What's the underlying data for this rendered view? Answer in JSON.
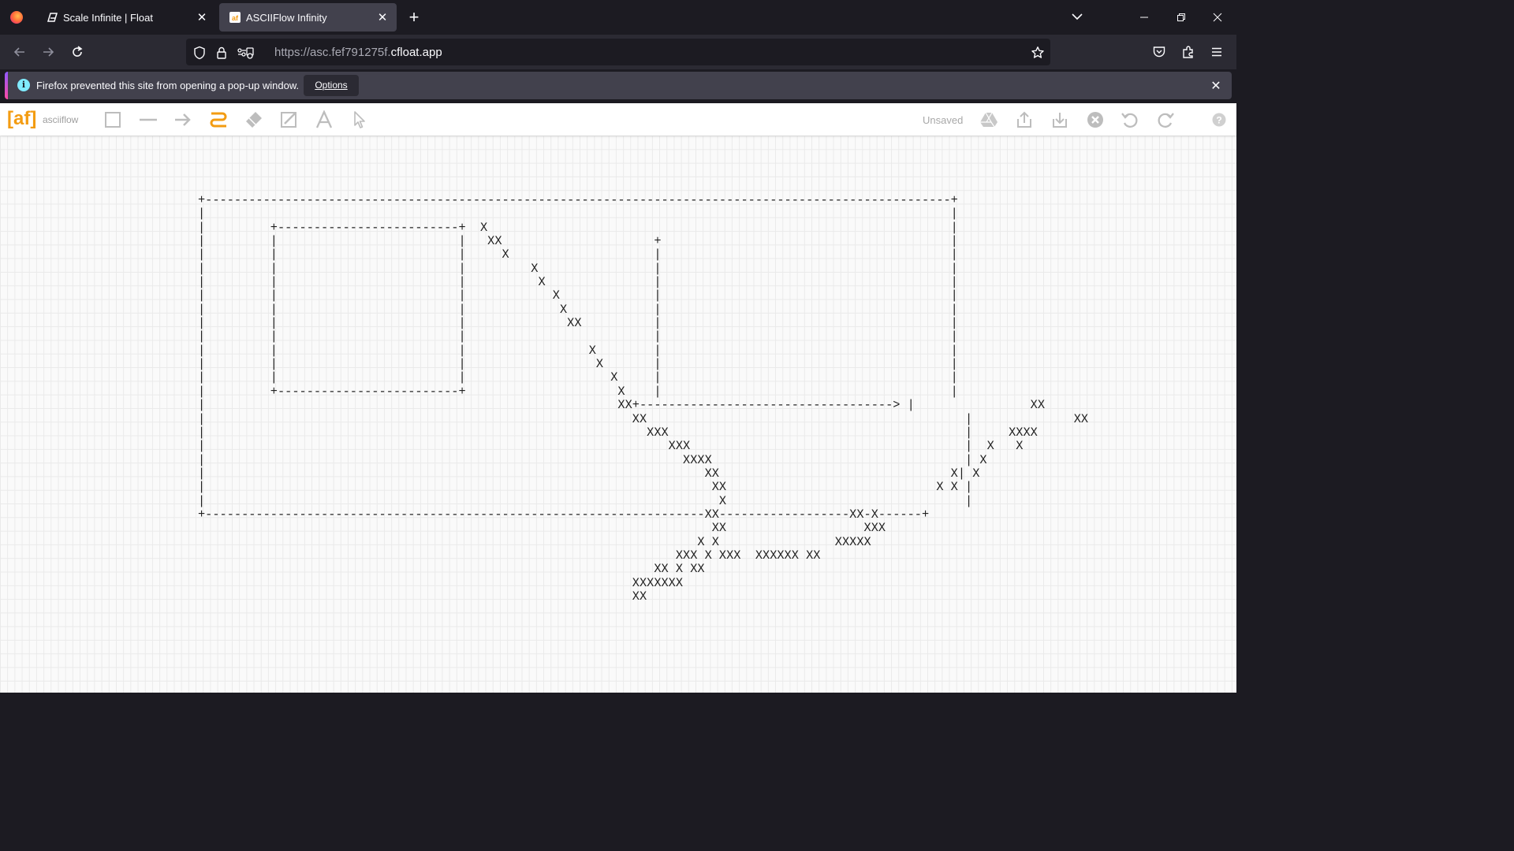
{
  "browser": {
    "tabs": [
      {
        "title": "Scale Infinite | Float",
        "active": false,
        "favicon": "float-icon"
      },
      {
        "title": "ASCIIFlow Infinity",
        "active": true,
        "favicon": "asciiflow-icon"
      }
    ],
    "url_dim": "https://asc.fef791275f.",
    "url_main": "cfloat.app"
  },
  "notification": {
    "message": "Firefox prevented this site from opening a pop-up window.",
    "options_label": "Options"
  },
  "app": {
    "logo": "[af]",
    "logo_text": "asciiflow",
    "status": "Unsaved",
    "tools": [
      "box-tool",
      "line-tool",
      "arrow-tool",
      "freeform-tool",
      "erase-tool",
      "resize-tool",
      "text-tool",
      "select-tool"
    ],
    "actions": [
      "drive-icon",
      "export-icon",
      "import-icon",
      "clear-icon",
      "undo-icon",
      "redo-icon",
      "help-icon"
    ],
    "active_tool": "freeform-tool",
    "accent_color": "#f39c12"
  },
  "canvas": {
    "ascii_art": "+-------------------------------------------------------------------------------------------------------+\n|                                                                                                       |\n|         +-------------------------+  X                                                                |\n|         |                         |   XX                     +                                        |\n|         |                         |     X                    |                                        |\n|         |                         |         X                |                                        |\n|         |                         |          X               |                                        |\n|         |                         |            X             |                                        |\n|         |                         |             X            |                                        |\n|         |                         |              XX          |                                        |\n|         |                         |                          |                                        |\n|         |                         |                 X        |                                        |\n|         |                         |                  X       |                                        |\n|         |                         |                    X     |                                        |\n|         +-------------------------+                     X    |                                        |\n|                                                         XX+-----------------------------------> |                XX\n|                                                           XX                                            |              XX\n|                                                             XXX                                         |     XXXX\n|                                                                XXX                                      |  X   X\n|                                                                  XXXX                                   | X\n|                                                                     XX                                X| X\n|                                                                      XX                             X X |\n|                                                                       X                                 |\n+---------------------------------------------------------------------XX------------------XX-X------+\n                                                                       XX                   XXX\n                                                                     X X                XXXXX\n                                                                  XXX X XXX  XXXXXX XX\n                                                               XX X XX\n                                                            XXXXXXX\n                                                            XX"
  }
}
